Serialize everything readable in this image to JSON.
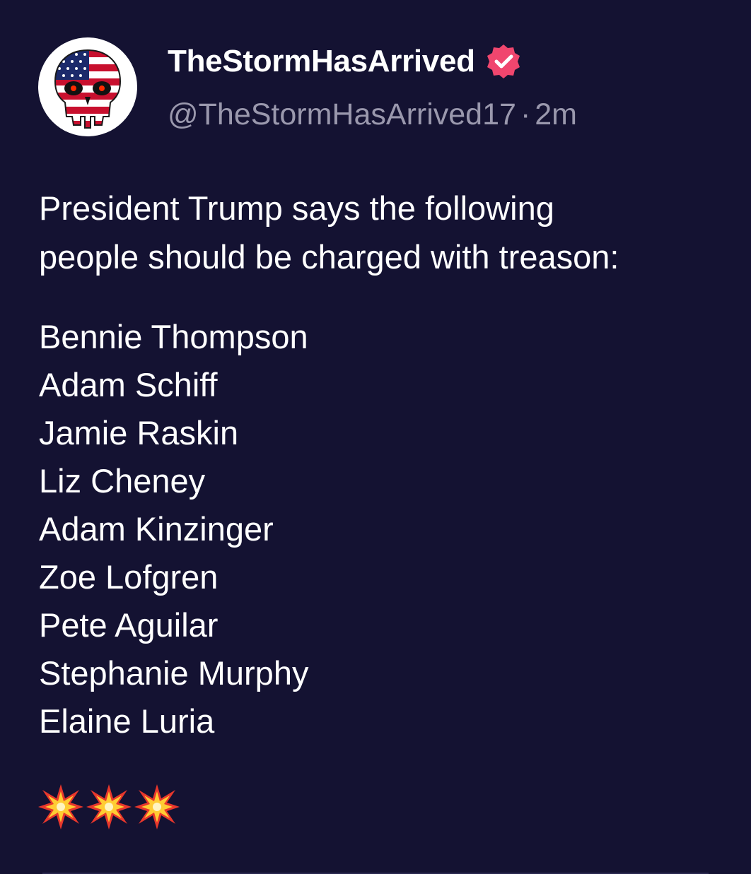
{
  "post": {
    "display_name": "TheStormHasArrived",
    "handle": "@TheStormHasArrived17",
    "separator": "·",
    "time": "2m",
    "verified_color": "#f0466e",
    "intro_line1": "President Trump says the following",
    "intro_line2": "people should be charged with treason:",
    "names": [
      "Bennie Thompson",
      "Adam Schiff",
      "Jamie Raskin",
      "Liz Cheney",
      "Adam Kinzinger",
      "Zoe Lofgren",
      "Pete Aguilar",
      "Stephanie Murphy",
      "Elaine Luria"
    ],
    "emojis": [
      "collision-emoji",
      "collision-emoji",
      "collision-emoji"
    ]
  },
  "colors": {
    "background": "#141232",
    "text": "#ffffff",
    "muted": "#9a98ad"
  }
}
